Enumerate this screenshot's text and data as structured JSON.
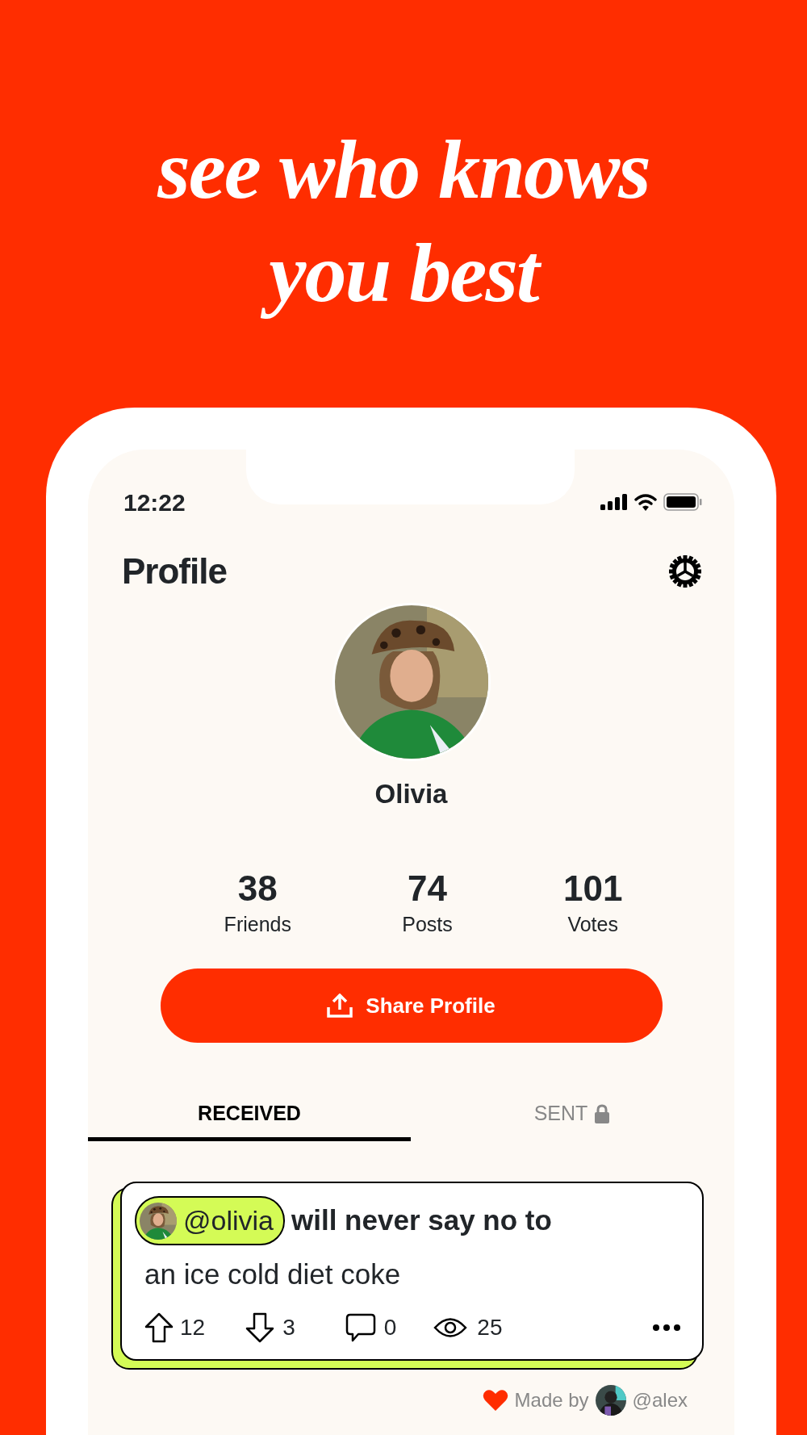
{
  "headline_lines": [
    "see who knows",
    "you best"
  ],
  "status_bar": {
    "time": "12:22"
  },
  "header": {
    "title": "Profile"
  },
  "profile": {
    "name": "Olivia"
  },
  "stats": [
    {
      "value": "38",
      "label": "Friends"
    },
    {
      "value": "74",
      "label": "Posts"
    },
    {
      "value": "101",
      "label": "Votes"
    }
  ],
  "share_button": {
    "label": "Share Profile"
  },
  "tabs": [
    {
      "label": "RECEIVED",
      "selected": true,
      "locked": false
    },
    {
      "label": "SENT",
      "selected": false,
      "locked": true
    }
  ],
  "posts": [
    {
      "mention": "@olivia",
      "lead": "will never say no to",
      "text": "an ice cold diet coke",
      "upvotes": "12",
      "downvotes": "3",
      "comments": "0",
      "views": "25"
    }
  ],
  "footer": {
    "made_by": "Made by",
    "author": "@alex"
  }
}
